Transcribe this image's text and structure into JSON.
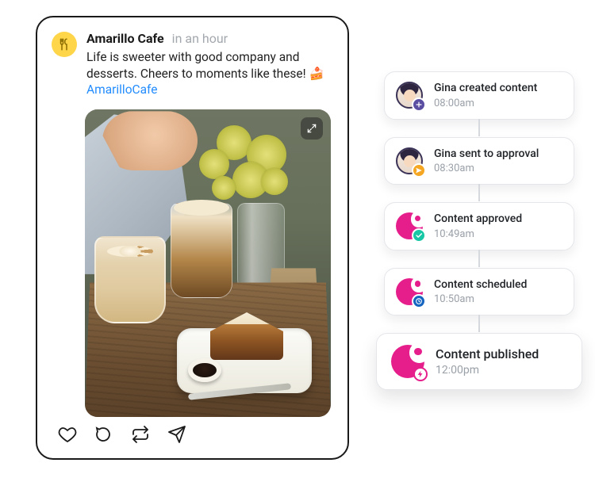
{
  "post": {
    "account_name": "Amarillo Cafe",
    "time_text": "in an hour",
    "caption_text": "Life is sweeter with good company and desserts. Cheers to moments like these!",
    "caption_emoji": "🍰",
    "caption_hashtag": "AmarilloCafe",
    "avatar_icon": "utensils-icon",
    "expand_icon": "expand-icon",
    "actions": {
      "like": "heart-icon",
      "comment": "chat-icon",
      "repost": "repeat-icon",
      "share": "send-icon"
    }
  },
  "timeline": [
    {
      "label": "Gina created content",
      "time": "08:00am",
      "icon": "persona",
      "badge": "plus",
      "badge_color": "purple"
    },
    {
      "label": "Gina sent to approval",
      "time": "08:30am",
      "icon": "persona",
      "badge": "send",
      "badge_color": "orange"
    },
    {
      "label": "Content approved",
      "time": "10:49am",
      "icon": "brand",
      "badge": "check",
      "badge_color": "teal"
    },
    {
      "label": "Content scheduled",
      "time": "10:50am",
      "icon": "brand",
      "badge": "clock",
      "badge_color": "blue"
    },
    {
      "label": "Content published",
      "time": "12:00pm",
      "icon": "brand",
      "badge": "bolt",
      "badge_color": "pinkhl",
      "emphasis": true
    }
  ]
}
